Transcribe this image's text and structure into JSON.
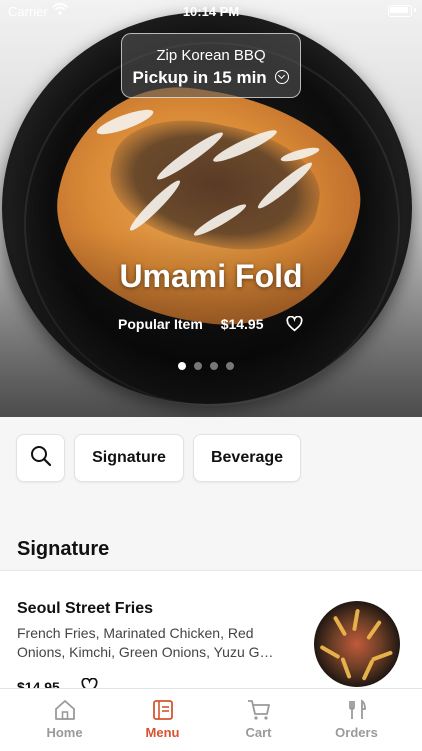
{
  "status_bar": {
    "carrier": "Carrier",
    "time": "10:14 PM"
  },
  "header": {
    "restaurant": "Zip Korean BBQ",
    "pickup": "Pickup in 15 min",
    "featured_title": "Umami Fold",
    "featured_tag": "Popular Item",
    "featured_price": "$14.95",
    "carousel": {
      "count": 4,
      "active_index": 0
    }
  },
  "filters": {
    "search_icon": "search-icon",
    "chips": [
      "Signature",
      "Beverage"
    ]
  },
  "section": {
    "title": "Signature"
  },
  "items": [
    {
      "name": "Seoul Street Fries",
      "description": "French Fries, Marinated Chicken, Red Onions, Kimchi, Green Onions, Yuzu G…",
      "price": "$14.95"
    }
  ],
  "tabbar": {
    "tabs": [
      {
        "label": "Home",
        "icon": "home-icon"
      },
      {
        "label": "Menu",
        "icon": "menu-icon"
      },
      {
        "label": "Cart",
        "icon": "cart-icon"
      },
      {
        "label": "Orders",
        "icon": "orders-icon"
      }
    ],
    "active": "Menu",
    "accent": "#d8542f"
  }
}
